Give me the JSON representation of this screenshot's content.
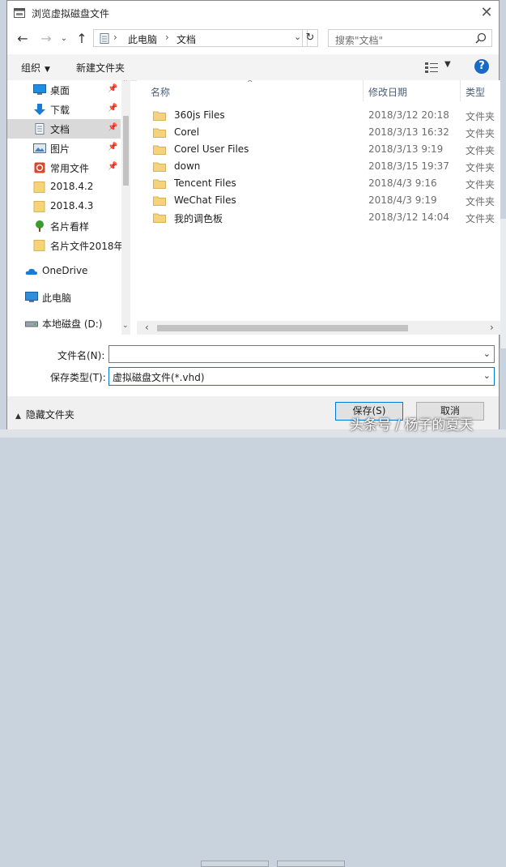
{
  "window": {
    "title": "浏览虚拟磁盘文件"
  },
  "address": {
    "segments": [
      "此电脑",
      "文档"
    ],
    "separator": "›"
  },
  "search": {
    "placeholder": "搜索\"文档\""
  },
  "toolbar": {
    "organize": "组织",
    "new_folder": "新建文件夹",
    "help": "?"
  },
  "nav": {
    "items": [
      {
        "label": "桌面",
        "icon": "desktop-icon",
        "pinned": true
      },
      {
        "label": "下载",
        "icon": "download-icon",
        "pinned": true
      },
      {
        "label": "文档",
        "icon": "documents-icon",
        "pinned": true,
        "selected": true
      },
      {
        "label": "图片",
        "icon": "pictures-icon",
        "pinned": true
      },
      {
        "label": "常用文件",
        "icon": "common-files-icon",
        "pinned": true
      },
      {
        "label": "2018.4.2",
        "icon": "folder-icon"
      },
      {
        "label": "2018.4.3",
        "icon": "folder-icon"
      },
      {
        "label": "名片看样",
        "icon": "tree-icon"
      },
      {
        "label": "名片文件2018年",
        "icon": "folder-icon"
      },
      {
        "label": "OneDrive",
        "icon": "onedrive-icon"
      },
      {
        "label": "此电脑",
        "icon": "this-pc-icon"
      },
      {
        "label": "本地磁盘 (D:)",
        "icon": "drive-icon"
      }
    ]
  },
  "files": {
    "columns": {
      "name": "名称",
      "date": "修改日期",
      "type": "类型"
    },
    "rows": [
      {
        "name": "360js Files",
        "date": "2018/3/12 20:18",
        "type": "文件夹"
      },
      {
        "name": "Corel",
        "date": "2018/3/13 16:32",
        "type": "文件夹"
      },
      {
        "name": "Corel User Files",
        "date": "2018/3/13 9:19",
        "type": "文件夹"
      },
      {
        "name": "down",
        "date": "2018/3/15 19:37",
        "type": "文件夹"
      },
      {
        "name": "Tencent Files",
        "date": "2018/4/3 9:16",
        "type": "文件夹"
      },
      {
        "name": "WeChat Files",
        "date": "2018/4/3 9:19",
        "type": "文件夹"
      },
      {
        "name": "我的调色板",
        "date": "2018/3/12 14:04",
        "type": "文件夹"
      }
    ]
  },
  "form": {
    "filename_label": "文件名(N):",
    "filename_value": "",
    "filetype_label": "保存类型(T):",
    "filetype_value": "虚拟磁盘文件(*.vhd)"
  },
  "footer": {
    "hide_folders": "隐藏文件夹",
    "save": "保存(S)",
    "cancel": "取消"
  },
  "watermark": "头条号 / 杨子的夏天",
  "colors": {
    "accent": "#0078d7",
    "folder": "#f4d37a",
    "selected": "#d9d9d9"
  }
}
